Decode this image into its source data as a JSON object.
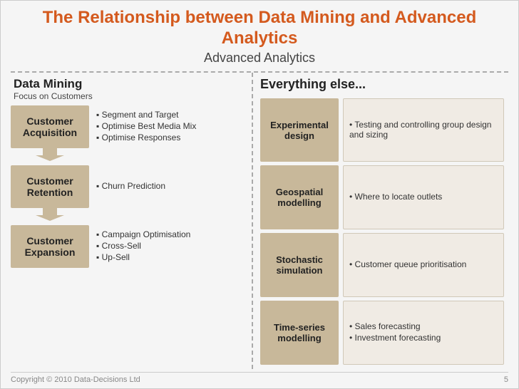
{
  "slide": {
    "title_main": "The Relationship between Data Mining and Advanced Analytics",
    "title_sub": "Advanced Analytics",
    "left": {
      "heading": "Data Mining",
      "subheading": "Focus on Customers",
      "customers": [
        {
          "label": "Customer Acquisition",
          "bullets": [
            "Segment and Target",
            "Optimise Best Media Mix",
            "Optimise Responses"
          ]
        },
        {
          "label": "Customer Retention",
          "bullets": [
            "Churn Prediction"
          ]
        },
        {
          "label": "Customer Expansion",
          "bullets": [
            "Campaign Optimisation",
            "Cross-Sell",
            "Up-Sell"
          ]
        }
      ]
    },
    "right": {
      "heading": "Everything else...",
      "items": [
        {
          "label": "Experimental design",
          "desc": [
            "Testing and controlling group design and sizing"
          ]
        },
        {
          "label": "Geospatial modelling",
          "desc": [
            "Where to locate outlets"
          ]
        },
        {
          "label": "Stochastic simulation",
          "desc": [
            "Customer queue prioritisation"
          ]
        },
        {
          "label": "Time-series modelling",
          "desc": [
            "Sales forecasting",
            "Investment forecasting"
          ]
        }
      ]
    },
    "footer": {
      "copyright": "Copyright © 2010 Data-Decisions Ltd",
      "page": "5"
    }
  }
}
